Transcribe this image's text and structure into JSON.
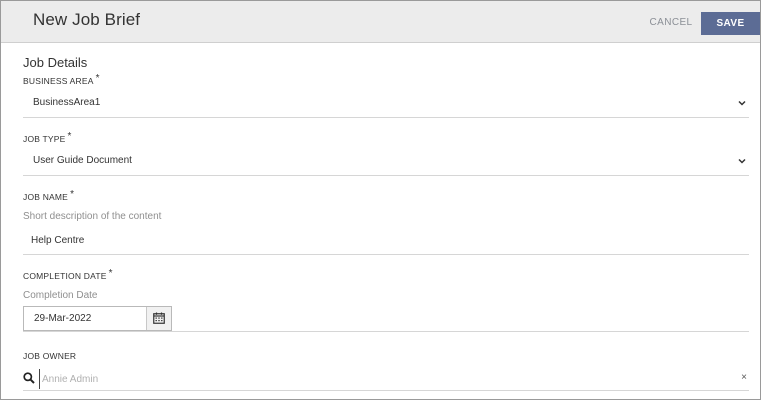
{
  "header": {
    "title": "New Job Brief",
    "cancel_label": "CANCEL",
    "save_label": "SAVE"
  },
  "form": {
    "section_title": "Job Details",
    "required_marker": "*",
    "business_area": {
      "label": "BUSINESS AREA",
      "value": "BusinessArea1",
      "icon": "chevron-down-icon"
    },
    "job_type": {
      "label": "JOB TYPE",
      "value": "User Guide Document",
      "icon": "chevron-down-icon"
    },
    "job_name": {
      "label": "JOB NAME",
      "hint": "Short description of the content",
      "value": "Help Centre"
    },
    "completion_date": {
      "label": "COMPLETION DATE",
      "hint": "Completion Date",
      "value": "29-Mar-2022",
      "icon": "calendar-icon"
    },
    "job_owner": {
      "label": "JOB OWNER",
      "placeholder": "Annie Admin",
      "search_icon": "search-icon",
      "clear_glyph": "×"
    }
  },
  "colors": {
    "header_bg": "#ececec",
    "save_button_bg": "#5c6c95",
    "cancel_text": "#8b8f96",
    "divider": "#d6d6d6"
  }
}
